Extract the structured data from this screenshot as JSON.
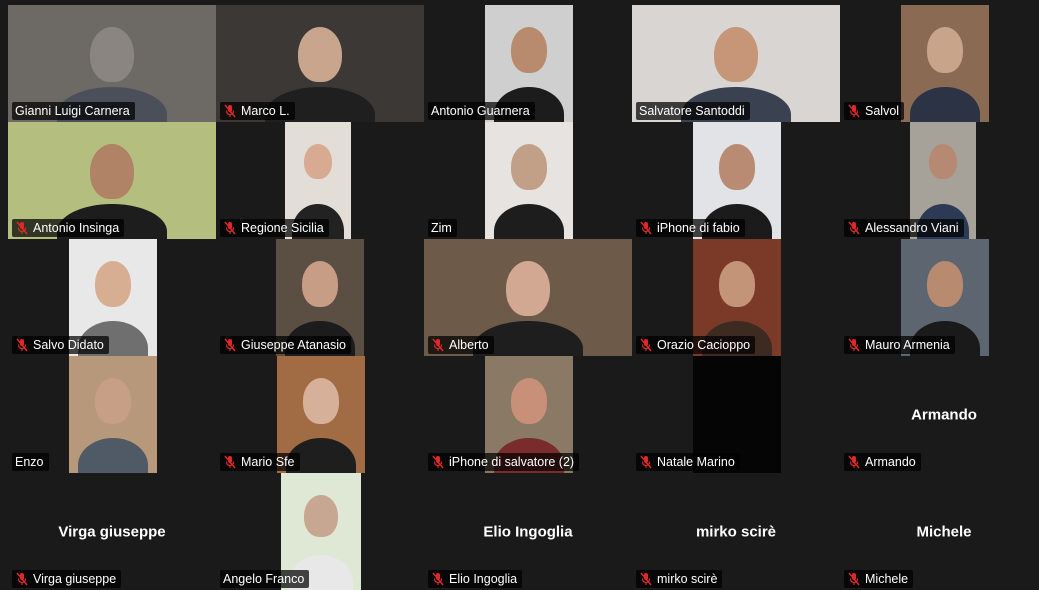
{
  "colors": {
    "background": "#1a1a1a",
    "active_speaker_border": "#23d959",
    "muted_icon": "#e02828",
    "name_text": "#ffffff"
  },
  "participants": [
    {
      "name": "Gianni Luigi Carnera",
      "muted": false,
      "video": true
    },
    {
      "name": "Marco L.",
      "muted": true,
      "video": true
    },
    {
      "name": "Antonio Guarnera",
      "muted": false,
      "video": true
    },
    {
      "name": "Salvatore Santoddi",
      "muted": false,
      "video": true,
      "active_speaker": true
    },
    {
      "name": "Salvol",
      "muted": true,
      "video": true
    },
    {
      "name": "Antonio Insinga",
      "muted": true,
      "video": true
    },
    {
      "name": "Regione Sicilia",
      "muted": true,
      "video": true
    },
    {
      "name": "Zim",
      "muted": false,
      "video": true
    },
    {
      "name": "iPhone di fabio",
      "muted": true,
      "video": true
    },
    {
      "name": "Alessandro Viani",
      "muted": true,
      "video": true
    },
    {
      "name": "Salvo Didato",
      "muted": true,
      "video": true
    },
    {
      "name": "Giuseppe Atanasio",
      "muted": true,
      "video": true
    },
    {
      "name": "Alberto",
      "muted": true,
      "video": true
    },
    {
      "name": "Orazio Cacioppo",
      "muted": true,
      "video": true
    },
    {
      "name": "Mauro Armenia",
      "muted": true,
      "video": true
    },
    {
      "name": "Enzo",
      "muted": false,
      "video": true
    },
    {
      "name": "Mario Sfe",
      "muted": true,
      "video": true
    },
    {
      "name": "iPhone di salvatore (2)",
      "muted": true,
      "video": true
    },
    {
      "name": "Natale Marino",
      "muted": true,
      "video": true
    },
    {
      "name": "Armando",
      "muted": true,
      "video": false,
      "display_name": "Armando"
    },
    {
      "name": "Virga giuseppe",
      "muted": true,
      "video": false,
      "display_name": "Virga giuseppe"
    },
    {
      "name": "Angelo Franco",
      "muted": false,
      "video": true
    },
    {
      "name": "Elio Ingoglia",
      "muted": true,
      "video": false,
      "display_name": "Elio Ingoglia"
    },
    {
      "name": "mirko scirè",
      "muted": true,
      "video": false,
      "display_name": "mirko scirè"
    },
    {
      "name": "Michele",
      "muted": true,
      "video": false,
      "display_name": "Michele"
    }
  ]
}
